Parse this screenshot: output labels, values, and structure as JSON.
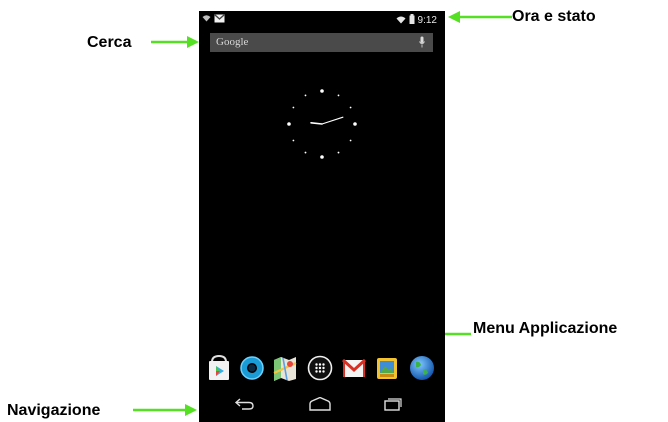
{
  "callouts": {
    "status": "Ora e stato",
    "search": "Cerca",
    "apps_menu": "Menu Applicazione",
    "navigation": "Navigazione"
  },
  "phone": {
    "status_bar": {
      "time": "9:12",
      "left_icons": [
        "wifi-icon",
        "gmail-icon"
      ],
      "right_icons": [
        "wifi-icon",
        "battery-icon"
      ]
    },
    "search_bar": {
      "label": "Google",
      "icon": "mic-icon"
    },
    "clock": {
      "hour": 9,
      "minute": 12
    },
    "dock": [
      {
        "name": "play-store-icon"
      },
      {
        "name": "browser-ring-icon"
      },
      {
        "name": "maps-icon"
      },
      {
        "name": "app-drawer-icon"
      },
      {
        "name": "gmail-icon"
      },
      {
        "name": "gallery-icon"
      },
      {
        "name": "globe-icon"
      }
    ],
    "navigation_bar": [
      "back-icon",
      "home-icon",
      "recent-apps-icon"
    ]
  },
  "colors": {
    "arrow": "#55e023",
    "phone_bg": "#000000",
    "search_bg": "#4a4a4a"
  }
}
